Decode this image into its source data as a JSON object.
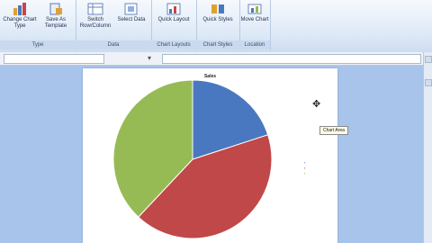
{
  "ribbon": {
    "groups": [
      {
        "label": "Type",
        "buttons": [
          "Change Chart Type",
          "Save As Template"
        ]
      },
      {
        "label": "Data",
        "buttons": [
          "Switch Row/Column",
          "Select Data"
        ]
      },
      {
        "label": "Chart Layouts",
        "buttons": [
          "Quick Layout"
        ]
      },
      {
        "label": "Chart Styles",
        "buttons": [
          "Quick Styles"
        ]
      },
      {
        "label": "Location",
        "buttons": [
          "Move Chart"
        ]
      }
    ]
  },
  "chart": {
    "title": "Sales",
    "tooltip": "Chart Area"
  },
  "chart_data": {
    "type": "pie",
    "title": "Sales",
    "slices": [
      {
        "value": 0.2,
        "color": "#4a78c0"
      },
      {
        "value": 0.42,
        "color": "#c04848"
      },
      {
        "value": 0.38,
        "color": "#96bb54"
      }
    ]
  }
}
